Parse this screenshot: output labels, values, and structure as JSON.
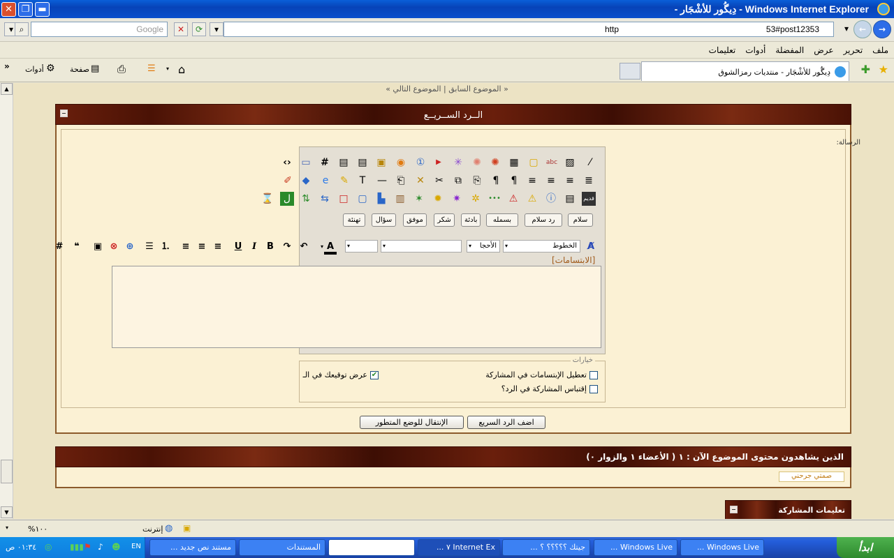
{
  "window": {
    "title": "Windows Internet Explorer - دِيگُور للأشْجَار - ",
    "close_label": "✕",
    "max_label": "❐",
    "min_label": "▬"
  },
  "address_bar": {
    "url_left": "http",
    "url_right": "53#post12353",
    "search_placeholder": "Google"
  },
  "menu": {
    "items": [
      "ملف",
      "تحرير",
      "عرض",
      "المفضلة",
      "أدوات",
      "تعليمات"
    ]
  },
  "toolbar": {
    "tab_title": "دِيگُور للأشْجَار - منتديات رمزالشوق",
    "page_label": "صفحة",
    "tools_label": "أدوات",
    "chevron": "»"
  },
  "page": {
    "thread_nav": "« الموضوع السابق | الموضوع التالي »",
    "quick_reply_title": "الــرد الســريــع",
    "message_label": "الرسالة:",
    "quick_buttons": [
      "سلام",
      "رد سلام",
      "بسمله",
      "بادئة",
      "شكر",
      "موفق",
      "سؤال",
      "تهنئة"
    ],
    "font_select": "الخطوط",
    "size_select": "الأحجا",
    "smilies_label": "[الابتسامات]",
    "options_legend": "خيارات",
    "opt_disable_smilies": "تعطيل الإبتسامات في المشاركة",
    "opt_quote": "إقتباس المشاركة في الرد؟",
    "opt_signature": "عرض توقيعك في الـ",
    "submit_label": "اضف الرد السريع",
    "advanced_label": "الإنتقال للوضع المتطور",
    "viewers_title": "الذين يشاهدون محتوى الموضوع الآن : ١ ( الأعضاء ١ والزوار ٠)",
    "viewer_member": "صمتي جرحني",
    "rules_title": "تعليمات المشاركة"
  },
  "status_bar": {
    "zone": "إنترنت",
    "zoom": "١٠٠%"
  },
  "taskbar": {
    "start": "ابدأ",
    "tasks": [
      "Windows Live ...",
      "Windows Live ...",
      "جيتك ؟؟؟؟؟ ؟ ...",
      "Internet Ex ٧ ...",
      "",
      "المستندات",
      "مستند نص جديد ..."
    ],
    "lang": "EN",
    "clock": "٠١:٣٤ ص"
  },
  "colors": {
    "panel_head": "#4a1205",
    "page_bg": "#ECE3C4",
    "panel_bg": "#FBF1D4",
    "accent": "#8B5A2B"
  }
}
